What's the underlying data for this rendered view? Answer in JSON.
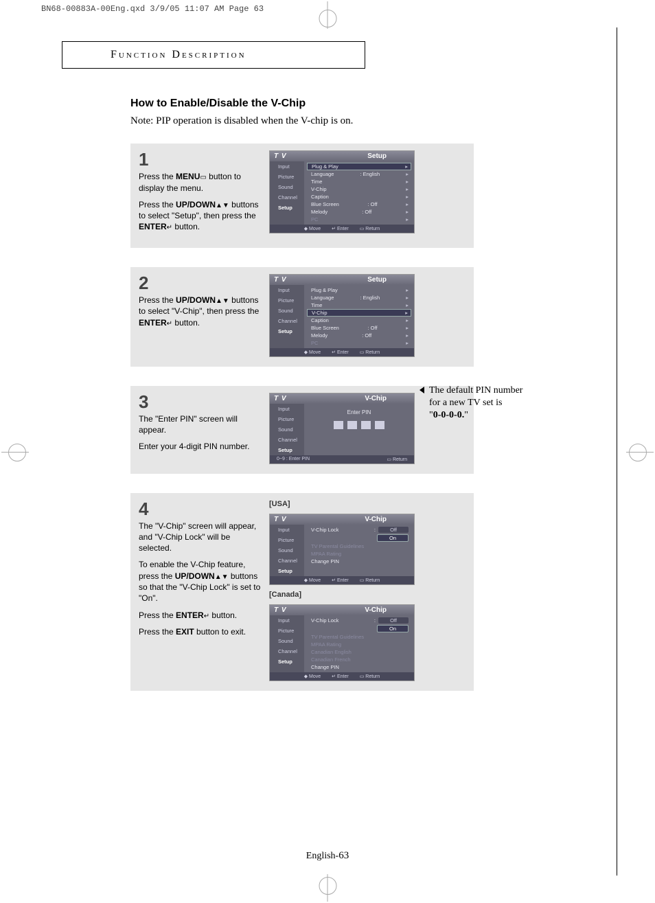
{
  "print_header": "BN68-00883A-00Eng.qxd  3/9/05 11:07 AM  Page 63",
  "title": "Function Description",
  "section_title": "How to Enable/Disable the V-Chip",
  "note": "Note: PIP operation is disabled when the V-chip is on.",
  "side_note_lines": [
    "The default PIN number",
    "for a new TV set is",
    "\"0-0-0-0.\""
  ],
  "page_footer_prefix": "English-",
  "page_number": "63",
  "sidebar_items": [
    "Input",
    "Picture",
    "Sound",
    "Channel",
    "Setup"
  ],
  "footbar": {
    "move": "Move",
    "enter": "Enter",
    "ret": "Return"
  },
  "step1": {
    "num": "1",
    "p1_a": "Press the ",
    "p1_b": "MENU",
    "p1_c": " button to display the menu.",
    "p2_a": "Press the ",
    "p2_b": "UP/DOWN",
    "p2_c": " buttons to select \"Setup\", then press the ",
    "p2_d": "ENTER",
    "p2_e": " button.",
    "osd_tv": "T V",
    "osd_title": "Setup",
    "rows": [
      {
        "l": "Plug & Play",
        "r": "",
        "hl": true
      },
      {
        "l": "Language",
        "r": ": English"
      },
      {
        "l": "Time",
        "r": ""
      },
      {
        "l": "V-Chip",
        "r": ""
      },
      {
        "l": "Caption",
        "r": ""
      },
      {
        "l": "Blue Screen",
        "r": ": Off"
      },
      {
        "l": "Melody",
        "r": ": Off"
      },
      {
        "l": "PC",
        "r": ""
      }
    ]
  },
  "step2": {
    "num": "2",
    "p1_a": "Press the ",
    "p1_b": "UP/DOWN",
    "p1_c": " buttons to select \"V-Chip\", then press the ",
    "p1_d": "ENTER",
    "p1_e": " button.",
    "osd_tv": "T V",
    "osd_title": "Setup",
    "rows": [
      {
        "l": "Plug & Play",
        "r": ""
      },
      {
        "l": "Language",
        "r": ": English"
      },
      {
        "l": "Time",
        "r": ""
      },
      {
        "l": "V-Chip",
        "r": "",
        "hl": true
      },
      {
        "l": "Caption",
        "r": ""
      },
      {
        "l": "Blue Screen",
        "r": ": Off"
      },
      {
        "l": "Melody",
        "r": ": Off"
      },
      {
        "l": "PC",
        "r": ""
      }
    ]
  },
  "step3": {
    "num": "3",
    "p1": "The \"Enter PIN\" screen will appear.",
    "p2": "Enter your 4-digit PIN number.",
    "osd_tv": "T V",
    "osd_title": "V-Chip",
    "pin_label": "Enter PIN",
    "foot_l": "0~9 : Enter PIN"
  },
  "step4": {
    "num": "4",
    "p1": "The \"V-Chip\" screen will appear, and \"V-Chip Lock\" will be selected.",
    "p2_a": "To enable the V-Chip feature, press the ",
    "p2_b": "UP/DOWN",
    "p2_c": " buttons so that the \"V-Chip Lock\" is set to \"On\".",
    "p3_a": "Press the ",
    "p3_b": "ENTER",
    "p3_c": " button.",
    "p4_a": "Press the ",
    "p4_b": "EXIT",
    "p4_c": " button to exit.",
    "label_usa": "[USA]",
    "label_can": "[Canada]",
    "osd_tv": "T V",
    "osd_title": "V-Chip",
    "usa_rows_lock": "V-Chip Lock",
    "off": "Off",
    "on": "On",
    "usa_items": [
      "TV Parental Guidelines",
      "MPAA Rating",
      "Change PIN"
    ],
    "can_items": [
      "TV Parental Guidelines",
      "MPAA Rating",
      "Canadian English",
      "Canadian French",
      "Change PIN"
    ]
  }
}
